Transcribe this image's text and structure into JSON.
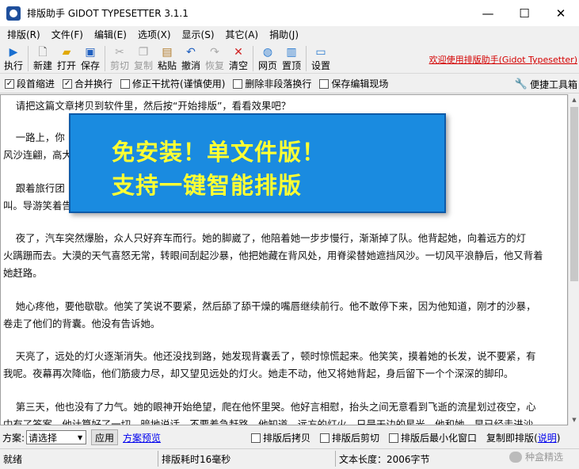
{
  "window": {
    "title": "排版助手 GIDOT TYPESETTER 3.1.1",
    "minimize": "—",
    "maximize": "☐",
    "close": "✕"
  },
  "menu": [
    "排版(R)",
    "文件(F)",
    "编辑(E)",
    "选项(X)",
    "显示(S)",
    "其它(A)",
    "捐助(J)"
  ],
  "toolbar": {
    "run": "执行",
    "new": "新建",
    "open": "打开",
    "save": "保存",
    "cut": "剪切",
    "copy": "复制",
    "paste": "粘贴",
    "undo": "撤消",
    "redo": "恢复",
    "clear": "清空",
    "web": "网页",
    "top": "置顶",
    "settings": "设置",
    "welcome": "欢迎使用排版助手(Gidot Typesetter)"
  },
  "options": {
    "indent": {
      "label": "段首缩进",
      "checked": true
    },
    "merge": {
      "label": "合并换行",
      "checked": true
    },
    "fix": {
      "label": "修正干扰符(谨慎使用)",
      "checked": false
    },
    "delete_breaks": {
      "label": "删除非段落换行",
      "checked": false
    },
    "save_scene": {
      "label": "保存编辑现场",
      "checked": false
    },
    "tools": "便捷工具箱"
  },
  "editor": {
    "paragraphs": [
      "    请把这篇文章拷贝到软件里，然后按“开始排版”，看看效果吧？",
      "",
      "    一路上，你                                                          一世如此相守。胡天八月，",
      "风沙连翩，高大                                                          么瘦。",
      "",
      "    跟着旅行团                                                          胡杨树上旋起的秃鹫吓得惊",
      "叫。导游笑着告",
      "",
      "    夜了，汽车突然爆胎，众人只好弃车而行。她的脚崴了，他陪着她一步步慢行，渐渐掉了队。他背起她，向着远方的灯",
      "火蹒跚而去。大漠的天气喜怒无常，转眼间刮起沙暴，他把她藏在背风处，用脊梁替她遮挡风沙。一切风平浪静后，他又背着",
      "她赶路。",
      "",
      "    她心疼他，要他歇歇。他笑了笑说不要紧，然后舔了舔干燥的嘴唇继续前行。他不敢停下来，因为他知道，刚才的沙暴，",
      "卷走了他们的背囊。他没有告诉她。",
      "",
      "    天亮了，远处的灯火逐渐消失。他还没找到路，她发现背囊丢了，顿时惊慌起来。他笑笑，摸着她的长发，说不要紧，有",
      "我呢。夜幕再次降临，他们筋疲力尽，却又望见远处的灯火。她走不动，他又将她背起，身后留下一个个深深的脚印。",
      "",
      "    第三天，他也没有了力气。她的眼神开始绝望，爬在他怀里哭。他好言相慰，抬头之间无意看到飞逝的流星划过夜空，心",
      "中有了答案。他计算好了一切，暗地说话，不要着急赶路。他知道，远方的灯火，只是天边的星光。他和她，早已经走进沙"
    ]
  },
  "promo": {
    "line1": "免安装！单文件版！",
    "line2": "支持一键智能排版"
  },
  "scheme": {
    "label": "方案:",
    "selected": "请选择",
    "apply": "应用",
    "preview": "方案预览",
    "copy_after": "排版后拷贝",
    "cut_after": "排版后剪切",
    "minimize_after": "排版后最小化窗口",
    "paste_restore": "复制即排版",
    "help": "说明"
  },
  "status": {
    "ready": "就绪",
    "time": "排版耗时16毫秒",
    "length": "文本长度：2006字节",
    "watermark": "种盒精选"
  }
}
